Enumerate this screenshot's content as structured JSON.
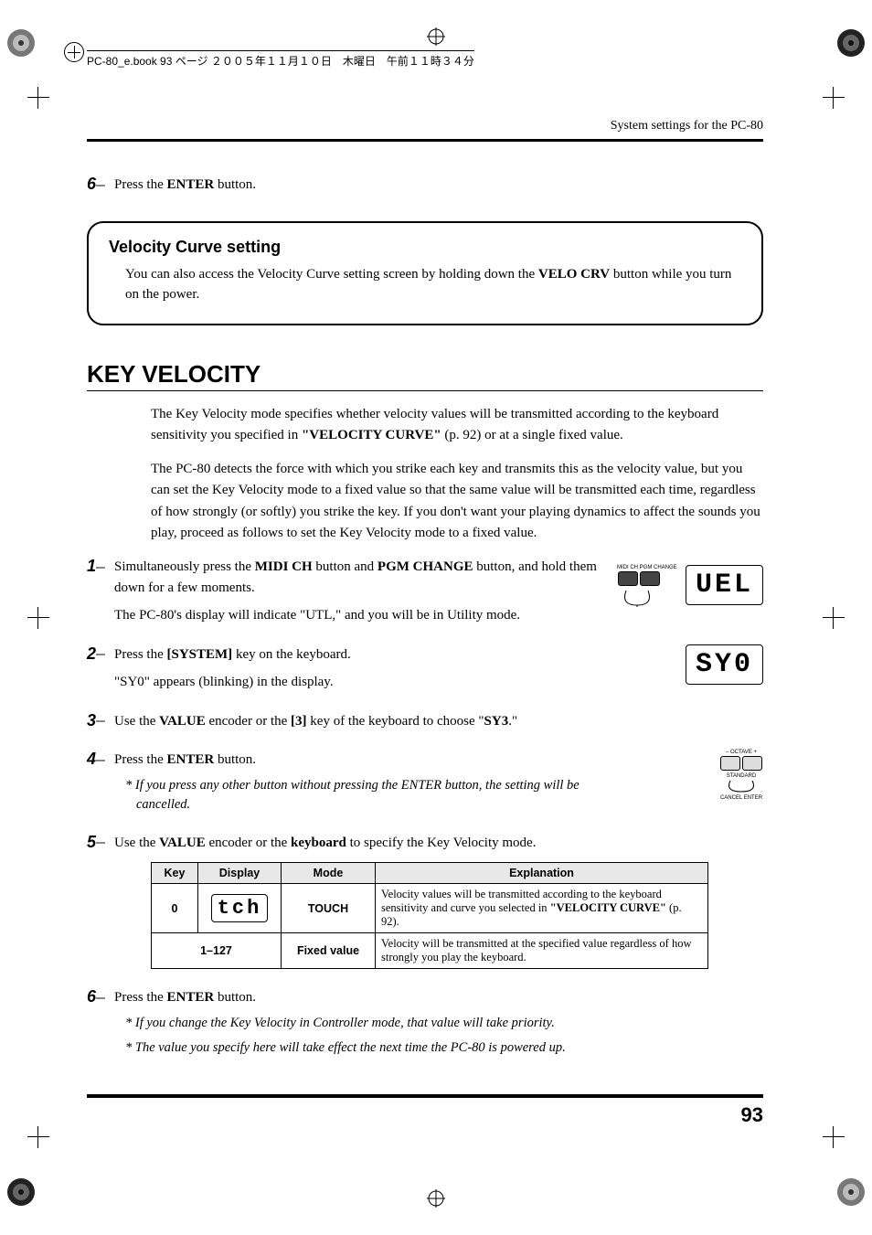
{
  "spine": "PC-80_e.book 93 ページ ２００５年１１月１０日　木曜日　午前１１時３４分",
  "running_head": "System settings for the PC-80",
  "pre_step": {
    "num": "6",
    "text_a": "Press the ",
    "bold_a": "ENTER",
    "text_b": " button."
  },
  "callout": {
    "title": "Velocity Curve setting",
    "body_a": "You can also access the Velocity Curve setting screen by holding down the ",
    "body_bold": "VELO CRV",
    "body_b": " button while you turn on the power."
  },
  "section_title": "KEY VELOCITY",
  "intro": {
    "p1_a": "The Key Velocity mode specifies whether velocity values will be transmitted according to the keyboard sensitivity you specified in ",
    "p1_bold": "\"VELOCITY CURVE\"",
    "p1_b": " (p. 92) or at a single fixed value.",
    "p2": "The PC-80 detects the force with which you strike each key and transmits this as the velocity value, but you can set the Key Velocity mode to a fixed value so that the same value will be transmitted each time, regardless of how strongly (or softly) you strike the key. If you don't want your playing dynamics to affect the sounds you play, proceed as follows to set the Key Velocity mode to a fixed value."
  },
  "steps": {
    "s1": {
      "num": "1",
      "line1_a": "Simultaneously press the ",
      "line1_b1": "MIDI CH",
      "line1_c": " button and ",
      "line1_b2": "PGM CHANGE",
      "line1_d": " button, and hold them down for a few moments.",
      "line2": "The PC-80's display will indicate \"UTL,\" and you will be in Utility mode.",
      "lcd": "UEL",
      "panel_label": "MIDI CH   PGM CHANGE"
    },
    "s2": {
      "num": "2",
      "line1_a": "Press the ",
      "line1_b": "[SYSTEM]",
      "line1_c": " key on the keyboard.",
      "line2": "\"SY0\" appears (blinking) in the display.",
      "lcd": "SY0"
    },
    "s3": {
      "num": "3",
      "line_a": "Use the ",
      "line_b1": "VALUE",
      "line_c": " encoder or the ",
      "line_b2": "[3]",
      "line_d": " key of the keyboard to choose \"",
      "line_b3": "SY3",
      "line_e": ".\""
    },
    "s4": {
      "num": "4",
      "line_a": "Press the ",
      "line_b": "ENTER",
      "line_c": " button.",
      "note": "* If you press any other button without pressing the ENTER button, the setting will be cancelled.",
      "panel_label_top": "– OCTAVE +",
      "panel_label_mid": "STANDARD",
      "panel_label_bot": "CANCEL   ENTER"
    },
    "s5": {
      "num": "5",
      "line_a": "Use the ",
      "line_b1": "VALUE",
      "line_c": " encoder or the ",
      "line_b2": "keyboard",
      "line_d": " to specify the Key Velocity mode."
    },
    "s6": {
      "num": "6",
      "line_a": "Press the ",
      "line_b": "ENTER",
      "line_c": " button.",
      "note1": "* If you change the Key Velocity in Controller mode, that value will take priority.",
      "note2": "* The value you specify here will take effect the next time the PC-80 is powered up."
    }
  },
  "table": {
    "headers": {
      "key": "Key",
      "display": "Display",
      "mode": "Mode",
      "explanation": "Explanation"
    },
    "rows": [
      {
        "key": "0",
        "display": "tch",
        "mode": "TOUCH",
        "exp_a": "Velocity values will be transmitted according to the keyboard sensitivity and curve you selected in ",
        "exp_b": "\"VELOCITY CURVE\"",
        "exp_c": " (p. 92)."
      },
      {
        "key": "1–127",
        "display": "",
        "mode": "Fixed value",
        "exp_a": "Velocity will be transmitted at the specified value regardless of how strongly you play the keyboard.",
        "exp_b": "",
        "exp_c": ""
      }
    ]
  },
  "page_number": "93"
}
